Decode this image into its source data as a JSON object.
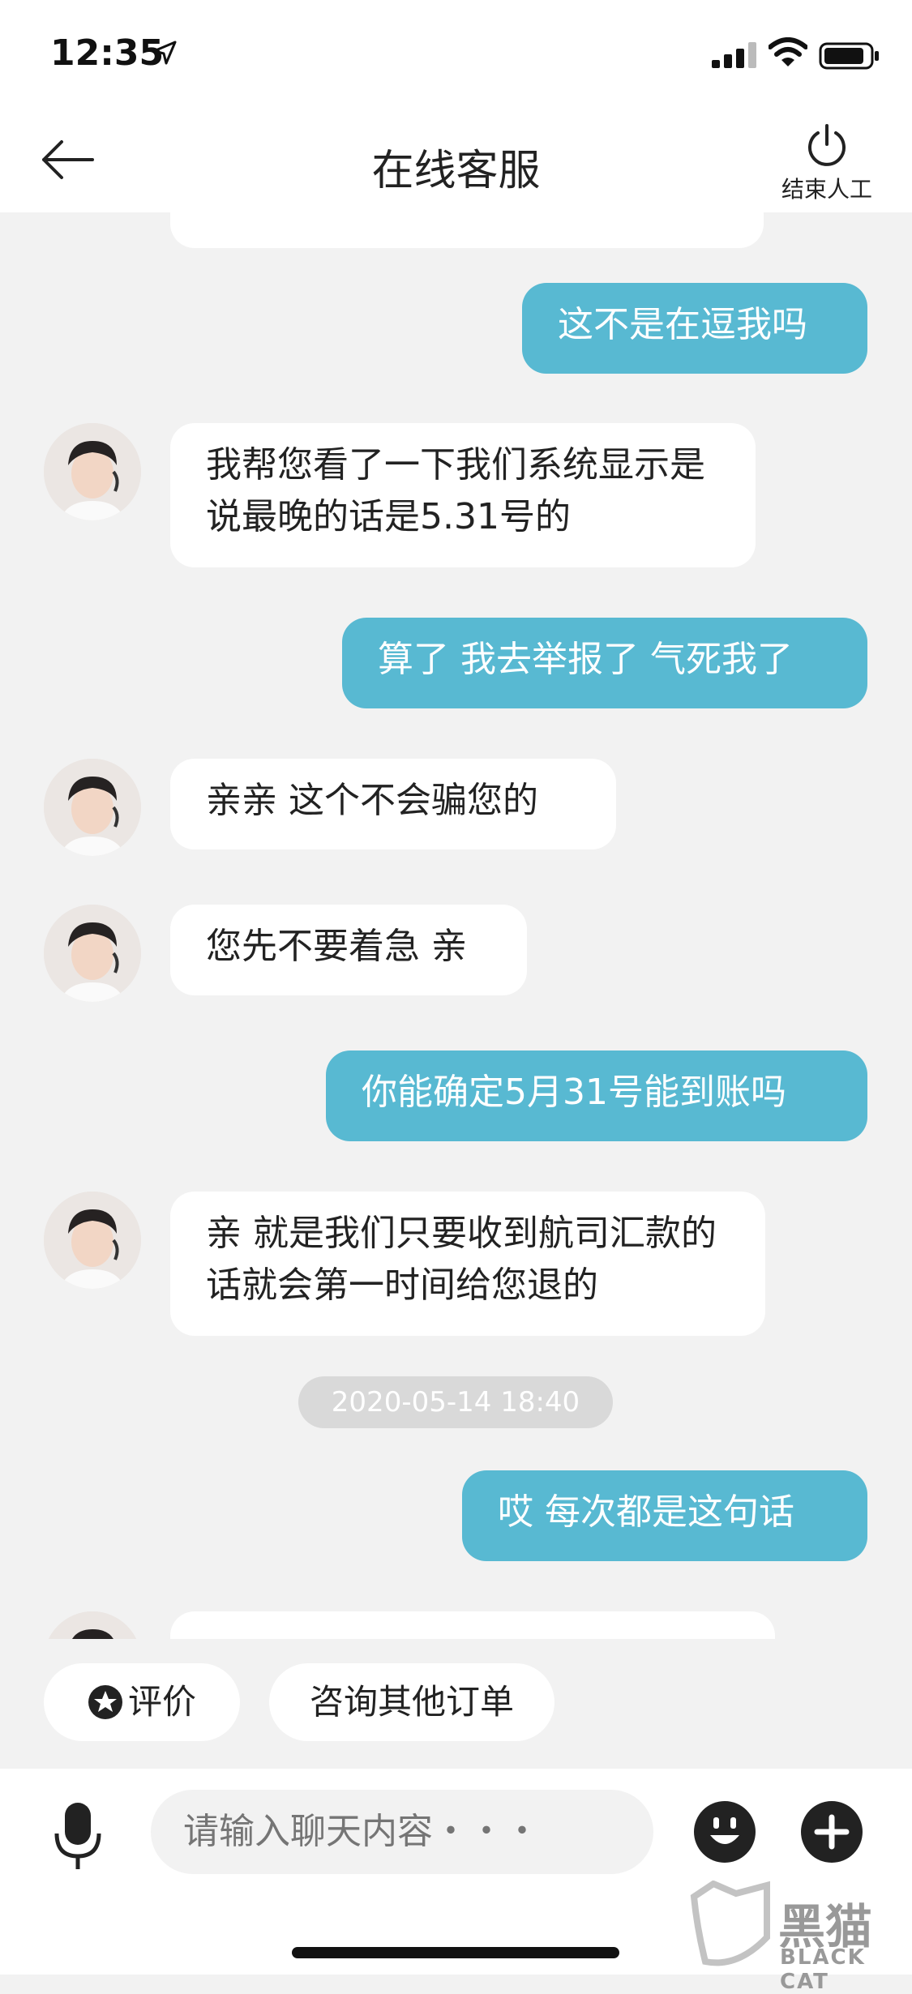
{
  "status_bar": {
    "time": "12:35"
  },
  "nav": {
    "title": "在线客服",
    "end_label": "结束人工"
  },
  "messages": [
    {
      "side": "right",
      "text": "这不是在逗我吗"
    },
    {
      "side": "left",
      "text": "我帮您看了一下我们系统显示是说最晚的话是5.31号的"
    },
    {
      "side": "right",
      "text": "算了 我去举报了 气死我了"
    },
    {
      "side": "left",
      "text": "亲亲 这个不会骗您的"
    },
    {
      "side": "left",
      "text": "您先不要着急 亲"
    },
    {
      "side": "right",
      "text": "你能确定5月31号能到账吗"
    },
    {
      "side": "left",
      "text": "亲 就是我们只要收到航司汇款的话就会第一时间给您退的"
    },
    {
      "side": "timestamp",
      "text": "2020-05-14 18:40"
    },
    {
      "side": "right",
      "text": "哎 每次都是这句话"
    }
  ],
  "quick_replies": {
    "rate": "评价",
    "other_orders": "咨询其他订单"
  },
  "input": {
    "placeholder": "请输入聊天内容・・・"
  },
  "watermark": {
    "title": "黑猫",
    "subtitle": "BLACK CAT"
  },
  "colors": {
    "accent": "#58b9d2",
    "background": "#f2f2f2"
  }
}
